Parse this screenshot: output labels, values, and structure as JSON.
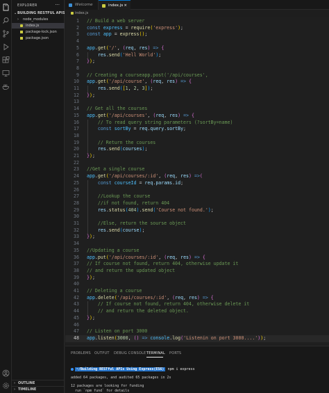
{
  "explorer": {
    "title": "EXPLORER",
    "more": "···",
    "project": "BUILDING RESTFUL APIS U...",
    "items": [
      {
        "label": "node_modules",
        "kind": "folder"
      },
      {
        "label": "index.js",
        "kind": "js",
        "active": true
      },
      {
        "label": "package-lock.json",
        "kind": "json"
      },
      {
        "label": "package.json",
        "kind": "json"
      }
    ],
    "outline": "OUTLINE",
    "timeline": "TIMELINE"
  },
  "tabs": [
    {
      "label": "Welcome",
      "active": false
    },
    {
      "label": "index.js",
      "active": true,
      "close": "×"
    }
  ],
  "breadcrumb": "index.js",
  "editor": {
    "current_line": 48,
    "lines": [
      {
        "n": "1",
        "t": [
          [
            "com",
            "// Build a web server"
          ]
        ]
      },
      {
        "n": "2",
        "t": [
          [
            "kw",
            "const "
          ],
          [
            "var",
            "express"
          ],
          [
            "p",
            " = "
          ],
          [
            "fn",
            "require"
          ],
          [
            "br1",
            "("
          ],
          [
            "str",
            "'express'"
          ],
          [
            "br1",
            ")"
          ],
          [
            "p",
            ";"
          ]
        ]
      },
      {
        "n": "3",
        "t": [
          [
            "kw",
            "const "
          ],
          [
            "var",
            "app"
          ],
          [
            "p",
            " = "
          ],
          [
            "fn",
            "express"
          ],
          [
            "br1",
            "()"
          ],
          [
            "p",
            ";"
          ]
        ]
      },
      {
        "n": "4",
        "t": []
      },
      {
        "n": "5",
        "t": [
          [
            "var",
            "app"
          ],
          [
            "p",
            "."
          ],
          [
            "fn",
            "get"
          ],
          [
            "br1",
            "("
          ],
          [
            "str",
            "'/'"
          ],
          [
            "p",
            ", "
          ],
          [
            "br2",
            "("
          ],
          [
            "id",
            "req"
          ],
          [
            "p",
            ", "
          ],
          [
            "id",
            "res"
          ],
          [
            "br2",
            ")"
          ],
          [
            "kw",
            " => "
          ],
          [
            "br2",
            "{"
          ]
        ]
      },
      {
        "n": "6",
        "t": [
          [
            "p",
            "    "
          ],
          [
            "id",
            "res"
          ],
          [
            "p",
            "."
          ],
          [
            "fn",
            "send"
          ],
          [
            "br3",
            "("
          ],
          [
            "str",
            "'Hell World'"
          ],
          [
            "br3",
            ")"
          ],
          [
            "p",
            ";"
          ]
        ]
      },
      {
        "n": "7",
        "t": [
          [
            "br2",
            "}"
          ],
          [
            "br1",
            ")"
          ],
          [
            "p",
            ";"
          ]
        ]
      },
      {
        "n": "8",
        "t": []
      },
      {
        "n": "9",
        "t": [
          [
            "com",
            "// Creating a courseapp.post('/api/courses',"
          ]
        ]
      },
      {
        "n": "10",
        "t": [
          [
            "var",
            "app"
          ],
          [
            "p",
            "."
          ],
          [
            "fn",
            "get"
          ],
          [
            "br1",
            "("
          ],
          [
            "str",
            "'/api/course'"
          ],
          [
            "p",
            ", "
          ],
          [
            "br2",
            "("
          ],
          [
            "id",
            "req"
          ],
          [
            "p",
            ", "
          ],
          [
            "id",
            "res"
          ],
          [
            "br2",
            ")"
          ],
          [
            "kw",
            " => "
          ],
          [
            "br2",
            "{"
          ]
        ]
      },
      {
        "n": "11",
        "t": [
          [
            "p",
            "    "
          ],
          [
            "id",
            "res"
          ],
          [
            "p",
            "."
          ],
          [
            "fn",
            "send"
          ],
          [
            "br3",
            "("
          ],
          [
            "br1",
            "["
          ],
          [
            "num",
            "1"
          ],
          [
            "p",
            ", "
          ],
          [
            "num",
            "2"
          ],
          [
            "p",
            ", "
          ],
          [
            "num",
            "3"
          ],
          [
            "br1",
            "]"
          ],
          [
            "br3",
            ")"
          ],
          [
            "p",
            ";"
          ]
        ]
      },
      {
        "n": "12",
        "t": [
          [
            "br2",
            "}"
          ],
          [
            "br1",
            ")"
          ],
          [
            "p",
            ";"
          ]
        ]
      },
      {
        "n": "13",
        "t": []
      },
      {
        "n": "14",
        "t": [
          [
            "com",
            "// Get all the courses"
          ]
        ]
      },
      {
        "n": "15",
        "t": [
          [
            "var",
            "app"
          ],
          [
            "p",
            "."
          ],
          [
            "fn",
            "get"
          ],
          [
            "br1",
            "("
          ],
          [
            "str",
            "'/api/courses'"
          ],
          [
            "p",
            ", "
          ],
          [
            "br2",
            "("
          ],
          [
            "id",
            "req"
          ],
          [
            "p",
            ", "
          ],
          [
            "id",
            "res"
          ],
          [
            "br2",
            ")"
          ],
          [
            "kw",
            " => "
          ],
          [
            "br2",
            "{"
          ]
        ]
      },
      {
        "n": "16",
        "t": [
          [
            "p",
            "    "
          ],
          [
            "com",
            "// To read query string parameters (?sortBy=name)"
          ]
        ]
      },
      {
        "n": "17",
        "t": [
          [
            "p",
            "    "
          ],
          [
            "kw",
            "const "
          ],
          [
            "var",
            "sortBy"
          ],
          [
            "p",
            " = "
          ],
          [
            "id",
            "req"
          ],
          [
            "p",
            "."
          ],
          [
            "id",
            "query"
          ],
          [
            "p",
            "."
          ],
          [
            "id",
            "sortBy"
          ],
          [
            "p",
            ";"
          ]
        ]
      },
      {
        "n": "18",
        "t": []
      },
      {
        "n": "19",
        "t": [
          [
            "p",
            "    "
          ],
          [
            "com",
            "// Return the courses"
          ]
        ]
      },
      {
        "n": "20",
        "t": [
          [
            "p",
            "    "
          ],
          [
            "id",
            "res"
          ],
          [
            "p",
            "."
          ],
          [
            "fn",
            "send"
          ],
          [
            "br3",
            "("
          ],
          [
            "id",
            "courses"
          ],
          [
            "br3",
            ")"
          ],
          [
            "p",
            ";"
          ]
        ]
      },
      {
        "n": "21",
        "t": [
          [
            "br2",
            "}"
          ],
          [
            "br1",
            ")"
          ],
          [
            "p",
            ";"
          ]
        ]
      },
      {
        "n": "22",
        "t": []
      },
      {
        "n": "23",
        "t": [
          [
            "com",
            "//Get a single course"
          ]
        ]
      },
      {
        "n": "24",
        "t": [
          [
            "var",
            "app"
          ],
          [
            "p",
            "."
          ],
          [
            "fn",
            "get"
          ],
          [
            "br1",
            "("
          ],
          [
            "str",
            "'/api/courses/:id'"
          ],
          [
            "p",
            ", "
          ],
          [
            "br2",
            "("
          ],
          [
            "id",
            "req"
          ],
          [
            "p",
            ", "
          ],
          [
            "id",
            "res"
          ],
          [
            "br2",
            ")"
          ],
          [
            "kw",
            " =>"
          ],
          [
            "br2",
            "("
          ]
        ]
      },
      {
        "n": "25",
        "t": [
          [
            "p",
            "    "
          ],
          [
            "kw",
            "const "
          ],
          [
            "var",
            "courseId"
          ],
          [
            "p",
            " = "
          ],
          [
            "id",
            "req"
          ],
          [
            "p",
            "."
          ],
          [
            "id",
            "params"
          ],
          [
            "p",
            "."
          ],
          [
            "id",
            "id"
          ],
          [
            "p",
            ";"
          ]
        ]
      },
      {
        "n": "26",
        "t": []
      },
      {
        "n": "27",
        "t": [
          [
            "p",
            "    "
          ],
          [
            "com",
            "//Lookup the course"
          ]
        ]
      },
      {
        "n": "28",
        "t": [
          [
            "p",
            "    "
          ],
          [
            "com",
            "//if not found, return 404"
          ]
        ]
      },
      {
        "n": "29",
        "t": [
          [
            "p",
            "    "
          ],
          [
            "id",
            "res"
          ],
          [
            "p",
            "."
          ],
          [
            "fn",
            "status"
          ],
          [
            "br3",
            "("
          ],
          [
            "num",
            "404"
          ],
          [
            "br3",
            ")"
          ],
          [
            "p",
            "."
          ],
          [
            "fn",
            "send"
          ],
          [
            "br3",
            "("
          ],
          [
            "str",
            "'Course not found.'"
          ],
          [
            "br3",
            ")"
          ],
          [
            "p",
            ";"
          ]
        ]
      },
      {
        "n": "30",
        "t": []
      },
      {
        "n": "31",
        "t": [
          [
            "p",
            "    "
          ],
          [
            "com",
            "//Else, return the sourse object"
          ]
        ]
      },
      {
        "n": "32",
        "t": [
          [
            "p",
            "    "
          ],
          [
            "id",
            "res"
          ],
          [
            "p",
            "."
          ],
          [
            "fn",
            "send"
          ],
          [
            "br3",
            "("
          ],
          [
            "id",
            "course"
          ],
          [
            "br3",
            ")"
          ],
          [
            "p",
            ";"
          ]
        ]
      },
      {
        "n": "33",
        "t": [
          [
            "br2",
            "}"
          ],
          [
            "br1",
            ")"
          ],
          [
            "p",
            ";"
          ]
        ]
      },
      {
        "n": "34",
        "t": []
      },
      {
        "n": "35",
        "t": [
          [
            "com",
            "//Updating a course"
          ]
        ]
      },
      {
        "n": "36",
        "t": [
          [
            "var",
            "app"
          ],
          [
            "p",
            "."
          ],
          [
            "fn",
            "put"
          ],
          [
            "br1",
            "("
          ],
          [
            "str",
            "'/api/courses/:id'"
          ],
          [
            "p",
            ", "
          ],
          [
            "br2",
            "("
          ],
          [
            "id",
            "req"
          ],
          [
            "p",
            ", "
          ],
          [
            "id",
            "res"
          ],
          [
            "br2",
            ")"
          ],
          [
            "kw",
            " => "
          ],
          [
            "br2",
            "{"
          ]
        ]
      },
      {
        "n": "37",
        "t": [
          [
            "com",
            "// If course not found, return 404, otherwise update it"
          ]
        ]
      },
      {
        "n": "38",
        "t": [
          [
            "com",
            "// and return the updated object"
          ]
        ]
      },
      {
        "n": "39",
        "t": [
          [
            "br2",
            "}"
          ],
          [
            "br1",
            ")"
          ],
          [
            "p",
            ";"
          ]
        ]
      },
      {
        "n": "40",
        "t": []
      },
      {
        "n": "41",
        "t": [
          [
            "com",
            "// Deleting a course"
          ]
        ]
      },
      {
        "n": "42",
        "t": [
          [
            "var",
            "app"
          ],
          [
            "p",
            "."
          ],
          [
            "fn",
            "delete"
          ],
          [
            "br1",
            "("
          ],
          [
            "str",
            "'/api/courses/:id'"
          ],
          [
            "p",
            ", "
          ],
          [
            "br2",
            "("
          ],
          [
            "id",
            "req"
          ],
          [
            "p",
            ", "
          ],
          [
            "id",
            "res"
          ],
          [
            "br2",
            ")"
          ],
          [
            "kw",
            " => "
          ],
          [
            "br2",
            "{"
          ]
        ]
      },
      {
        "n": "43",
        "t": [
          [
            "p",
            "    "
          ],
          [
            "com",
            "// If course not found, return 404, otherwise delete it"
          ]
        ]
      },
      {
        "n": "44",
        "t": [
          [
            "p",
            "    "
          ],
          [
            "com",
            "// and return the deleted object."
          ]
        ]
      },
      {
        "n": "45",
        "t": [
          [
            "br2",
            "}"
          ],
          [
            "br1",
            ")"
          ],
          [
            "p",
            ";"
          ]
        ]
      },
      {
        "n": "46",
        "t": []
      },
      {
        "n": "47",
        "t": [
          [
            "com",
            "// Listen on port 3000"
          ]
        ]
      },
      {
        "n": "48",
        "t": [
          [
            "var",
            "app"
          ],
          [
            "p",
            "."
          ],
          [
            "fn",
            "listen"
          ],
          [
            "br1",
            "("
          ],
          [
            "num",
            "3000"
          ],
          [
            "p",
            ", "
          ],
          [
            "br2",
            "()"
          ],
          [
            "kw",
            " => "
          ],
          [
            "var",
            "console"
          ],
          [
            "p",
            "."
          ],
          [
            "fn",
            "log"
          ],
          [
            "br2",
            "("
          ],
          [
            "str",
            "'Listenin on port 3000....'"
          ],
          [
            "br2",
            ")"
          ],
          [
            "br1",
            ")"
          ],
          [
            "p",
            ";"
          ]
        ]
      }
    ]
  },
  "panel": {
    "tabs": [
      "PROBLEMS",
      "OUTPUT",
      "DEBUG CONSOLE",
      "TERMINAL",
      "PORTS"
    ],
    "active_tab": "TERMINAL",
    "terminal": {
      "prompt_badge": "~/Building RESTful APIs Using Express(ES6)",
      "command": "npm i express",
      "lines": [
        "added 64 packages, and audited 65 packages in 2s",
        "",
        "12 packages are looking for funding",
        "  run `npm fund` for details"
      ]
    }
  },
  "colors": {
    "accent": "#0078d4",
    "js_icon": "#cbcb41",
    "json_icon": "#cbcb41",
    "terminal_badge": "#2472c8"
  }
}
